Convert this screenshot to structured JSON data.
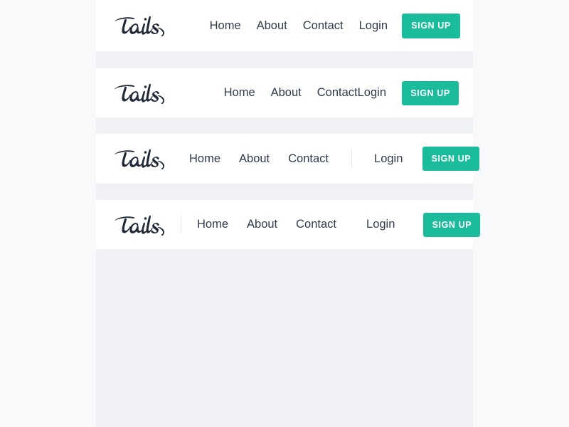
{
  "page": {
    "background_color": "#f7f9fa",
    "column_background_color": "#f0f1f4",
    "card_background_color": "#ffffff"
  },
  "brand": {
    "logo_text": "tails",
    "logo_color": "#1f2937"
  },
  "theme": {
    "accent_color": "#1abc9c",
    "link_color": "#2f3b4c",
    "divider_color": "#e2e5ea",
    "button_text_color": "#ffffff"
  },
  "navbars": [
    {
      "id": "navbar-1",
      "links": [
        "Home",
        "About",
        "Contact",
        "Login"
      ],
      "cta_label": "SIGN UP",
      "has_divider": false
    },
    {
      "id": "navbar-2",
      "links": [
        "Home",
        "About",
        "Contact",
        "Login"
      ],
      "cta_label": "SIGN UP",
      "has_divider": false
    },
    {
      "id": "navbar-3",
      "links": [
        "Home",
        "About",
        "Contact",
        "Login"
      ],
      "cta_label": "SIGN UP",
      "has_divider": true
    },
    {
      "id": "navbar-4",
      "links": [
        "Home",
        "About",
        "Contact",
        "Login"
      ],
      "cta_label": "SIGN UP",
      "has_divider": true
    }
  ]
}
